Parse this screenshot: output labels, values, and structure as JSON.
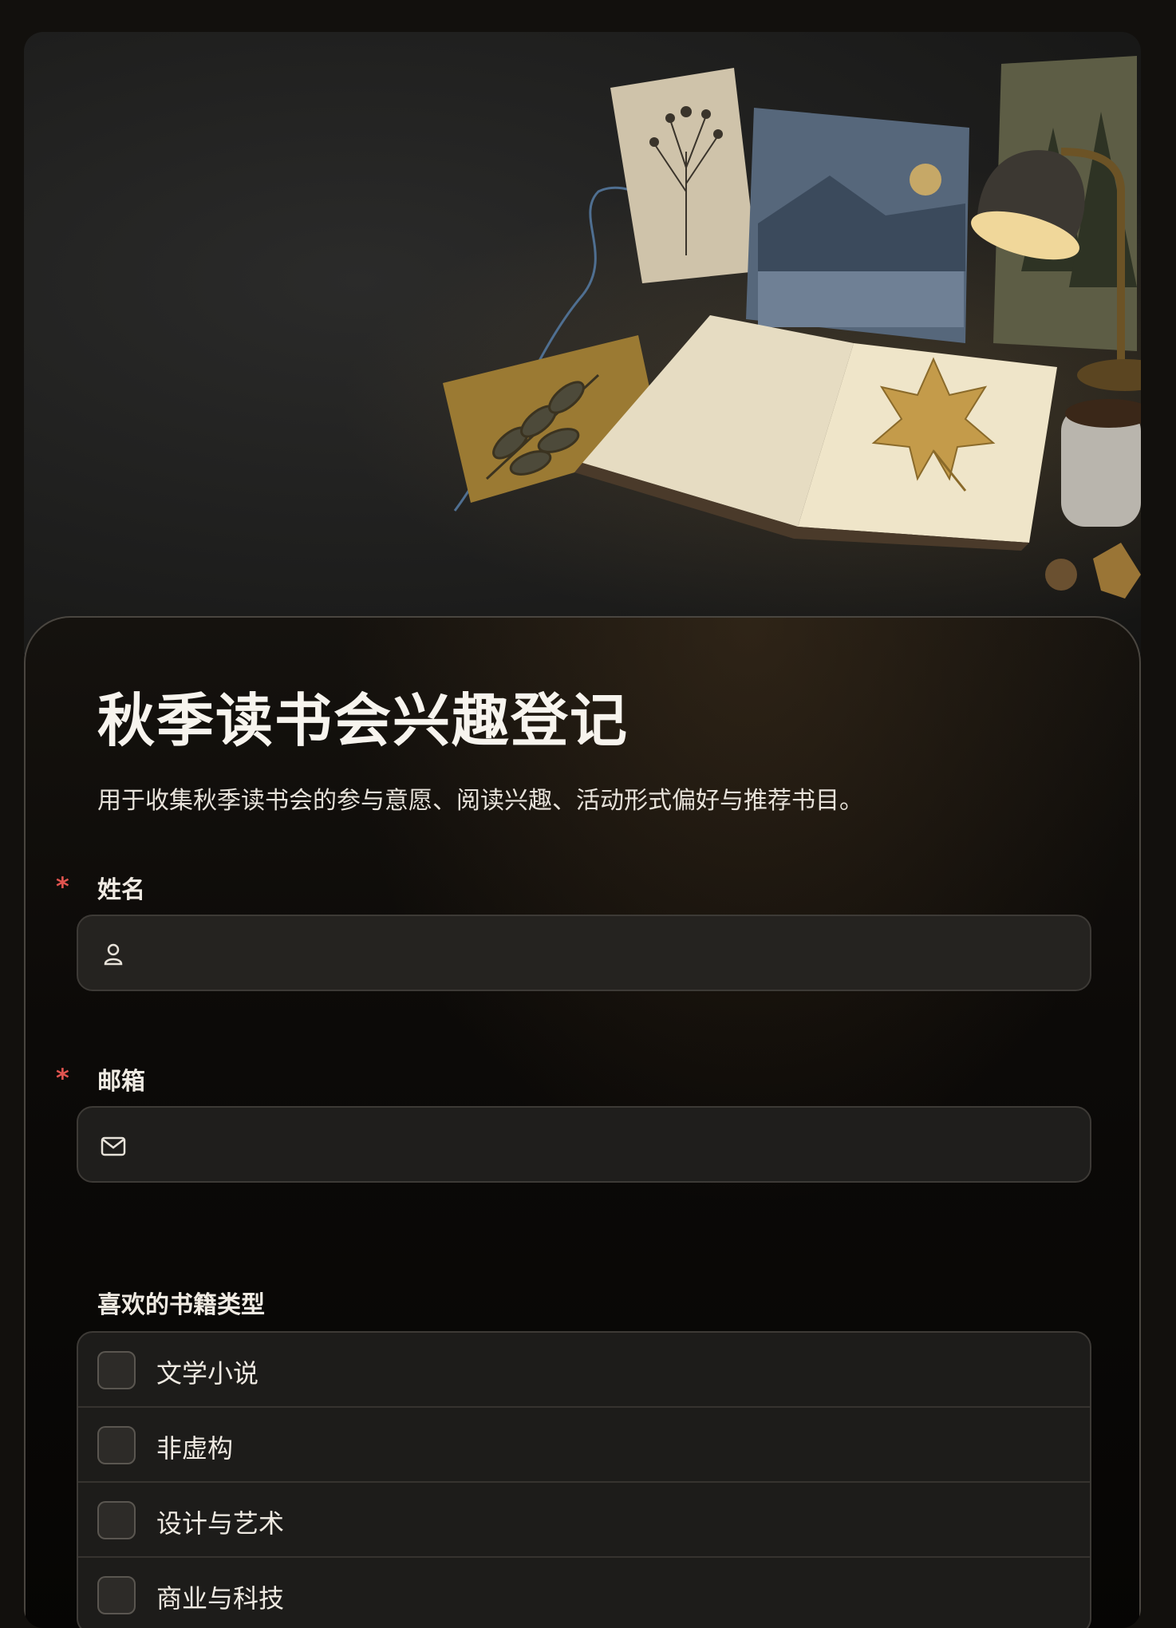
{
  "form": {
    "title": "秋季读书会兴趣登记",
    "description": "用于收集秋季读书会的参与意愿、阅读兴趣、活动形式偏好与推荐书目。"
  },
  "fields": {
    "name": {
      "label": "姓名",
      "required_mark": "*",
      "value": "",
      "icon": "user-icon"
    },
    "email": {
      "label": "邮箱",
      "required_mark": "*",
      "value": "",
      "icon": "mail-icon"
    },
    "genres": {
      "label": "喜欢的书籍类型",
      "options": [
        {
          "label": "文学小说",
          "checked": false
        },
        {
          "label": "非虚构",
          "checked": false
        },
        {
          "label": "设计与艺术",
          "checked": false
        },
        {
          "label": "商业与科技",
          "checked": false
        }
      ]
    }
  },
  "colors": {
    "background": "#12100d",
    "required": "#e0544f",
    "input_bg": "#252320",
    "border": "#3d3a36"
  }
}
